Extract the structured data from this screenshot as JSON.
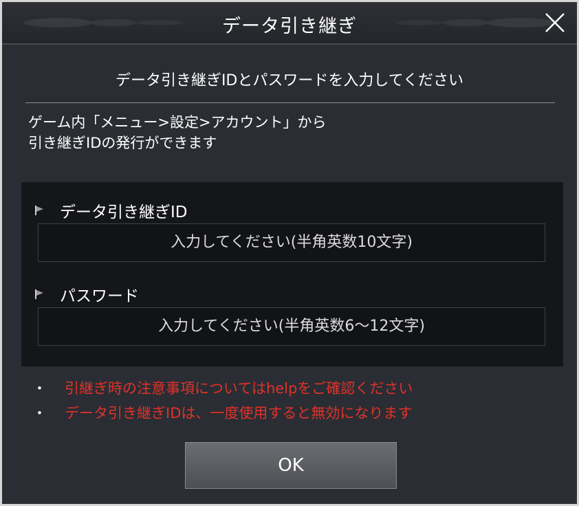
{
  "dialog": {
    "title": "データ引き継ぎ",
    "close_icon": "close-icon",
    "instruction": "データ引き継ぎIDとパスワードを入力してください",
    "info_line1": "ゲーム内「メニュー>設定>アカウント」から",
    "info_line2": "引き継ぎIDの発行ができます",
    "id_field": {
      "label": "データ引き継ぎID",
      "placeholder": "入力してください(半角英数10文字)"
    },
    "password_field": {
      "label": "パスワード",
      "placeholder": "入力してください(半角英数6〜12文字)"
    },
    "notes": [
      {
        "bullet": "・",
        "text": "引継ぎ時の注意事項についてはhelpをご確認ください"
      },
      {
        "bullet": "・",
        "text": "データ引き継ぎIDは、一度使用すると無効になります"
      }
    ],
    "ok_label": "OK"
  },
  "colors": {
    "warning": "#e0322b",
    "panel": "#141518",
    "button": "#5c5e63"
  }
}
